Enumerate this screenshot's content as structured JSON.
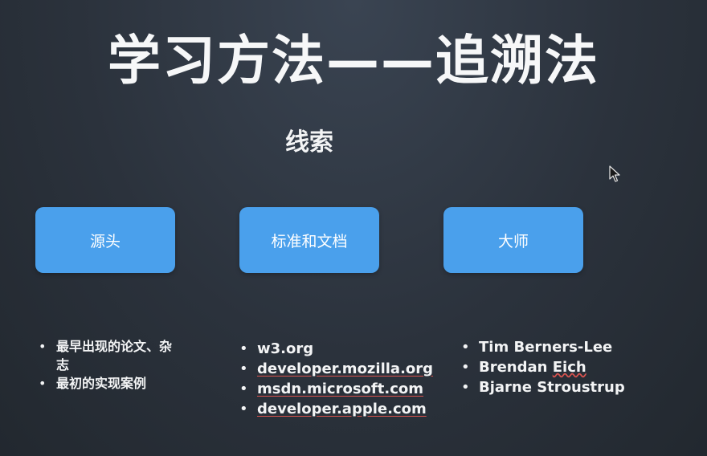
{
  "slide": {
    "title": "学习方法——追溯法",
    "subtitle": "线索",
    "cards": [
      {
        "label": "源头"
      },
      {
        "label": "标准和文档"
      },
      {
        "label": "大师"
      }
    ],
    "col1_items": [
      {
        "text": "最早出现的论文、杂志"
      },
      {
        "text": "最初的实现案例"
      }
    ],
    "col2_items": [
      {
        "text": "w3.org"
      },
      {
        "text": "developer.mozilla.org"
      },
      {
        "text": "msdn.microsoft.com"
      },
      {
        "text": "developer.apple.com"
      }
    ],
    "col3_items": [
      {
        "text": "Tim Berners-Lee"
      },
      {
        "pre": "Brendan ",
        "mark": "Eich"
      },
      {
        "text": "Bjarne Stroustrup"
      }
    ]
  },
  "colors": {
    "background": "#2b323c",
    "card": "#4aa0ec",
    "text": "#f3f4f5",
    "spellcheck_underline": "#d9534f"
  },
  "icons": [
    "mouse-cursor-icon"
  ]
}
